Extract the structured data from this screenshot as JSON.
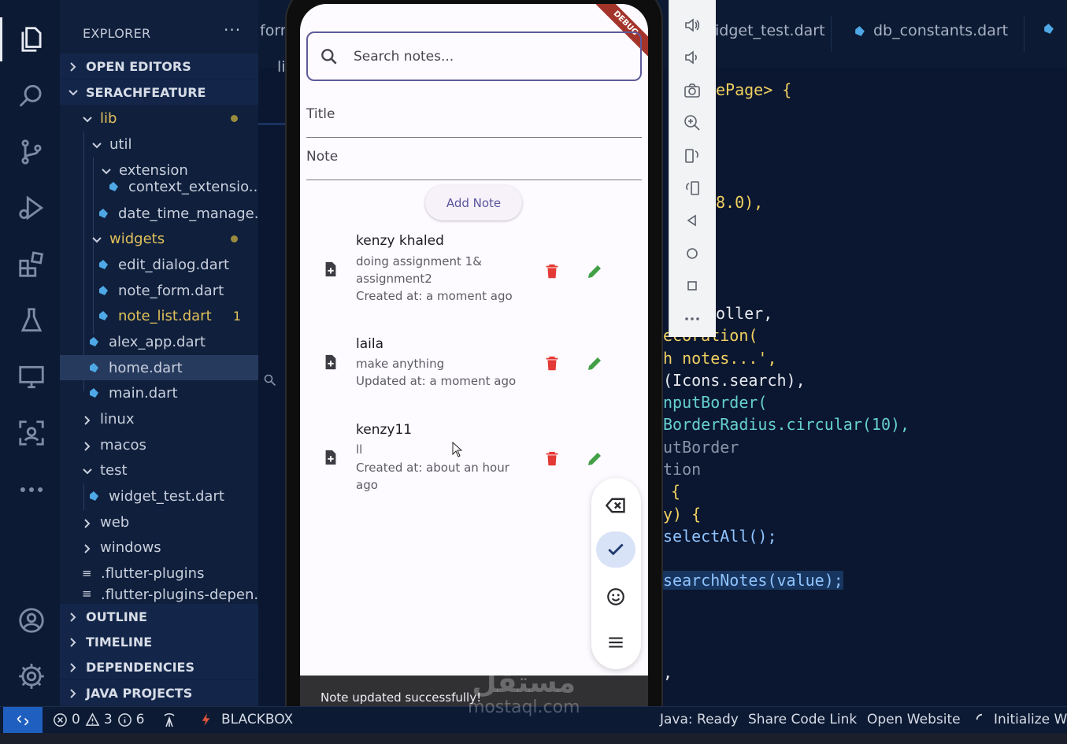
{
  "sidebar": {
    "title": "EXPLORER",
    "more": "···",
    "sections": {
      "open_editors": "OPEN EDITORS",
      "project": "SERACHFEATURE",
      "outline": "OUTLINE",
      "timeline": "TIMELINE",
      "dependencies": "DEPENDENCIES",
      "java_projects": "JAVA PROJECTS"
    },
    "tree": {
      "lib": "lib",
      "util": "util",
      "extension": "extension",
      "context_extension": "context_extensio...",
      "date_time_manager": "date_time_manage...",
      "widgets": "widgets",
      "edit_dialog": "edit_dialog.dart",
      "note_form": "note_form.dart",
      "note_list": "note_list.dart",
      "note_list_badge": "1",
      "alex_app": "alex_app.dart",
      "home": "home.dart",
      "main": "main.dart",
      "linux": "linux",
      "macos": "macos",
      "test": "test",
      "widget_test": "widget_test.dart",
      "web": "web",
      "windows": "windows",
      "flutter_plugins": ".flutter-plugins",
      "flutter_plugins_dep": ".flutter-plugins-depen..."
    }
  },
  "editor": {
    "tabs": {
      "left_fragment": "forn",
      "widget_test": "idget_test.dart",
      "db_constants": "db_constants.dart"
    },
    "left_line": "li",
    "code_lines": {
      "l1": "ePage> {",
      "l2": "8.0),",
      "l3": "oller,",
      "l4": "ecoration(",
      "l5": "h notes...',",
      "l6": "(Icons.search),",
      "l7": "nputBorder(",
      "l8": "BorderRadius.circular(10),",
      "l9": "utBorder",
      "l10": "tion",
      "l11": "{",
      "l12": "y) {",
      "l13": "selectAll();",
      "l14": "searchNotes(value);",
      "l15": ","
    }
  },
  "phone": {
    "debug_label": "DEBUG",
    "search_placeholder": "Search notes...",
    "title_placeholder": "Title",
    "note_placeholder": "Note",
    "add_button": "Add Note",
    "notes": [
      {
        "title": "kenzy khaled",
        "body": "doing assignment 1&",
        "body2": "assignment2",
        "meta": "Created at: a moment ago"
      },
      {
        "title": "laila",
        "body": "make anything",
        "meta": "Updated at: a moment ago"
      },
      {
        "title": "kenzy11",
        "body": "ll",
        "meta": "Created at: about an hour",
        "meta2": "ago"
      }
    ],
    "snackbar": "Note updated successfully!"
  },
  "statusbar": {
    "errors": "0",
    "warnings": "3",
    "info": "6",
    "blackbox": "BLACKBOX",
    "java": "Java: Ready",
    "share": "Share Code Link",
    "open_website": "Open Website",
    "initialize": "Initialize Wo"
  },
  "watermark": {
    "arabic": "مستقل",
    "latin": "mostaql.com"
  },
  "colors": {
    "delete": "#e53935",
    "edit": "#43a047",
    "accent": "#5e5a9a",
    "modified": "#e2c15a"
  }
}
